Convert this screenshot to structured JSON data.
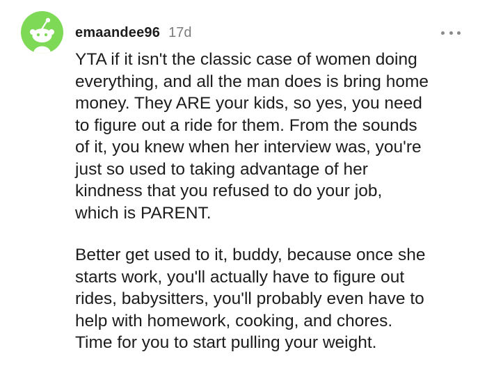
{
  "comment": {
    "username": "emaandee96",
    "timestamp": "17d",
    "avatar_icon": "reddit-snoo-avatar-icon",
    "avatar_color": "#7ed956",
    "more_icon": "more-options-icon",
    "paragraphs": [
      "YTA if it isn't the classic case of women doing\neverything, and all the man does is bring home\nmoney. They ARE your kids, so yes, you need\nto figure out a ride for them. From the sounds\nof it, you knew when her interview was, you're\njust so used to taking advantage of her\nkindness that you refused to do your job,\nwhich is PARENT.",
      "Better get used to it, buddy, because once she\nstarts work, you'll actually have to figure out\nrides, babysitters, you'll probably even have to\nhelp with homework, cooking, and chores.\nTime for you to start pulling your weight."
    ]
  }
}
